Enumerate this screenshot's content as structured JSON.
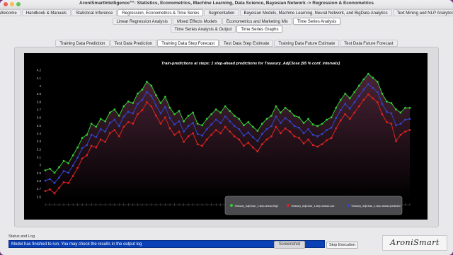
{
  "window": {
    "title": "AroniSmartIntelligence™: Statistics, Econometrics, Machine Learning, Data Science, Bayesian Network  -> Regression & Econometrics",
    "controls": {
      "close": "#ec5f57",
      "minimize": "#f5bf4f",
      "zoom": "#61c554"
    }
  },
  "tabs_main": [
    {
      "label": "Welcome"
    },
    {
      "label": "Handbook & Manuals"
    },
    {
      "label": "Statistical Inference"
    },
    {
      "label": "Regression, Econometrics & Time Series",
      "active": true
    },
    {
      "label": "Segmentation"
    },
    {
      "label": "Bayesian Models, Machine Learning, Neural Network, and BigData Analytics"
    },
    {
      "label": "Text Mining and NLP Analytics"
    }
  ],
  "tabs_sub1": [
    {
      "label": "Linear Regression Analysis"
    },
    {
      "label": "Mixed Effects Models"
    },
    {
      "label": "Econometrics and Marketing Mix"
    },
    {
      "label": "Time Series Analysis",
      "active": true
    }
  ],
  "tabs_sub2": [
    {
      "label": "Time Series Analysis & Output"
    },
    {
      "label": "Time Series Graphs",
      "active": true
    }
  ],
  "tabs_sub3": [
    {
      "label": "Training Data Prediction"
    },
    {
      "label": "Test Data Prediction"
    },
    {
      "label": "Training Data Step Forecast",
      "active": true
    },
    {
      "label": "Test  Data Step Estimate"
    },
    {
      "label": "Training Data Future Estimate"
    },
    {
      "label": "Test  Data Future Forecast"
    }
  ],
  "chart_data": {
    "type": "line",
    "title": "Train-predictions at steps: 1 step-ahead predictions for  Treasury_AdjClose  [95 % conf. intervals]",
    "xlabel": "",
    "ylabel": "",
    "y_ticks": [
      "2.6",
      "2.7",
      "2.8",
      "2.9",
      "3",
      "3.1",
      "3.2",
      "3.3",
      "3.4",
      "3.5",
      "3.6",
      "3.7",
      "3.8",
      "3.9",
      "4",
      "4.1",
      "4.2"
    ],
    "ylim": [
      2.55,
      4.25
    ],
    "x_tick_count": 80,
    "grid": false,
    "legend_position": "bottom-right",
    "colors": {
      "high": "#33cc33",
      "low": "#dd2222",
      "predicted": "#3344cc",
      "fill_top": "#3a1e2c"
    },
    "series": [
      {
        "name": "Treasury_AdjClose_1-step-ahead-High",
        "values": [
          2.93,
          2.95,
          2.9,
          2.97,
          3.05,
          3.02,
          3.12,
          3.22,
          3.34,
          3.38,
          3.52,
          3.48,
          3.58,
          3.55,
          3.66,
          3.7,
          3.62,
          3.74,
          3.8,
          3.78,
          3.9,
          3.95,
          4.05,
          4.0,
          3.88,
          3.78,
          3.86,
          3.72,
          3.64,
          3.68,
          3.55,
          3.62,
          3.66,
          3.52,
          3.5,
          3.58,
          3.64,
          3.7,
          3.66,
          3.74,
          3.68,
          3.62,
          3.58,
          3.5,
          3.54,
          3.48,
          3.43,
          3.52,
          3.58,
          3.62,
          3.74,
          3.66,
          3.72,
          3.68,
          3.62,
          3.6,
          3.53,
          3.58,
          3.51,
          3.49,
          3.52,
          3.57,
          3.6,
          3.72,
          3.82,
          3.9,
          3.84,
          3.92,
          4.0,
          4.08,
          4.15,
          4.1,
          4.05,
          3.9,
          3.8,
          3.78,
          3.7,
          3.66,
          3.72,
          3.72
        ]
      },
      {
        "name": "Treasury_AdjClose_1-step-ahead-Low",
        "values": [
          2.67,
          2.69,
          2.64,
          2.71,
          2.78,
          2.77,
          2.86,
          2.96,
          3.08,
          3.12,
          3.24,
          3.22,
          3.32,
          3.29,
          3.4,
          3.44,
          3.36,
          3.48,
          3.54,
          3.52,
          3.64,
          3.69,
          3.79,
          3.74,
          3.62,
          3.52,
          3.6,
          3.46,
          3.38,
          3.42,
          3.29,
          3.36,
          3.4,
          3.26,
          3.24,
          3.32,
          3.38,
          3.44,
          3.4,
          3.48,
          3.42,
          3.36,
          3.32,
          3.24,
          3.28,
          3.22,
          3.17,
          3.26,
          3.32,
          3.36,
          3.48,
          3.4,
          3.46,
          3.42,
          3.36,
          3.34,
          3.27,
          3.32,
          3.25,
          3.23,
          3.26,
          3.31,
          3.34,
          3.46,
          3.56,
          3.64,
          3.58,
          3.66,
          3.74,
          3.82,
          3.89,
          3.84,
          3.79,
          3.64,
          3.54,
          3.52,
          3.3,
          3.38,
          3.42,
          3.44
        ]
      },
      {
        "name": "Treasury_AdjClose_1-step-ahead-predicted",
        "values": [
          2.8,
          2.82,
          2.77,
          2.84,
          2.92,
          2.9,
          2.99,
          3.09,
          3.21,
          3.25,
          3.38,
          3.35,
          3.45,
          3.42,
          3.53,
          3.57,
          3.49,
          3.61,
          3.67,
          3.65,
          3.77,
          3.82,
          3.92,
          3.87,
          3.75,
          3.65,
          3.73,
          3.59,
          3.51,
          3.55,
          3.42,
          3.49,
          3.53,
          3.39,
          3.37,
          3.45,
          3.51,
          3.57,
          3.53,
          3.61,
          3.55,
          3.49,
          3.45,
          3.37,
          3.41,
          3.35,
          3.3,
          3.39,
          3.45,
          3.49,
          3.61,
          3.53,
          3.59,
          3.55,
          3.49,
          3.47,
          3.4,
          3.45,
          3.38,
          3.36,
          3.39,
          3.44,
          3.47,
          3.59,
          3.69,
          3.77,
          3.71,
          3.79,
          3.87,
          3.95,
          4.02,
          3.97,
          3.92,
          3.77,
          3.67,
          3.65,
          3.5,
          3.52,
          3.57,
          3.58
        ]
      }
    ]
  },
  "status": {
    "label": "Status and Log",
    "log_text": "Model has finished to run. You may check the results in the output log"
  },
  "buttons": {
    "screenshot": "Screenshot",
    "stop": "Stop Execution"
  },
  "logo_text": "AroniSmart"
}
